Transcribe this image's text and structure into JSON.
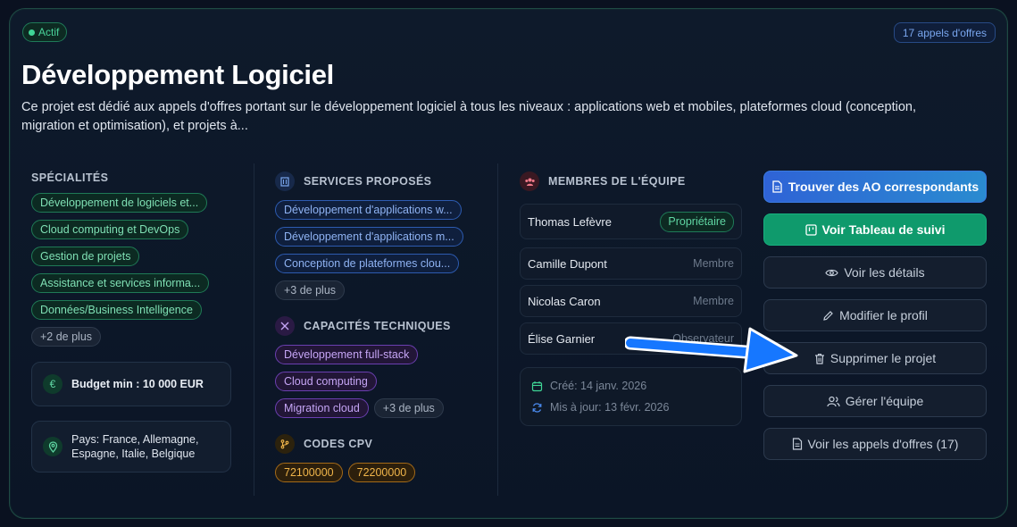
{
  "status": {
    "label": "Actif"
  },
  "ao_count": "17 appels d'offres",
  "title": "Développement Logiciel",
  "description": "Ce projet est dédié aux appels d'offres portant sur le développement logiciel à tous les niveaux : applications web et mobiles, plateformes cloud (conception, migration et optimisation), et projets à...",
  "specialites": {
    "title": "SPÉCIALITÉS",
    "tags": [
      "Développement de logiciels et...",
      "Cloud computing et DevOps",
      "Gestion de projets",
      "Assistance et services informa...",
      "Données/Business Intelligence"
    ],
    "more": "+2 de plus"
  },
  "budget": {
    "label": "Budget min : 10 000 EUR"
  },
  "pays": {
    "label": "Pays: France, Allemagne, Espagne, Italie, Belgique"
  },
  "services": {
    "title": "SERVICES PROPOSÉS",
    "tags": [
      "Développement d'applications w...",
      "Développement d'applications m...",
      "Conception de plateformes clou..."
    ],
    "more": "+3 de plus"
  },
  "capacites": {
    "title": "CAPACITÉS TECHNIQUES",
    "tags": [
      "Développement full-stack",
      "Cloud computing",
      "Migration cloud"
    ],
    "more": "+3 de plus"
  },
  "cpv": {
    "title": "CODES CPV",
    "tags": [
      "72100000",
      "72200000"
    ]
  },
  "equipe": {
    "title": "MEMBRES DE L'ÉQUIPE",
    "members": [
      {
        "name": "Thomas Lefèvre",
        "role": "Propriétaire"
      },
      {
        "name": "Camille Dupont",
        "role": "Membre"
      },
      {
        "name": "Nicolas Caron",
        "role": "Membre"
      },
      {
        "name": "Élise Garnier",
        "role": "Observateur"
      }
    ]
  },
  "dates": {
    "created": "Créé: 14 janv. 2026",
    "updated": "Mis à jour: 13 févr. 2026"
  },
  "actions": {
    "find": "Trouver des AO correspondants",
    "board": "Voir Tableau de suivi",
    "details": "Voir les détails",
    "edit": "Modifier le profil",
    "delete": "Supprimer le projet",
    "team": "Gérer l'équipe",
    "view_ao": "Voir les appels d'offres (17)"
  },
  "colors": {
    "accent_green": "#0f9a6c",
    "accent_blue": "#2f63d6",
    "arrow": "#1677ff"
  }
}
